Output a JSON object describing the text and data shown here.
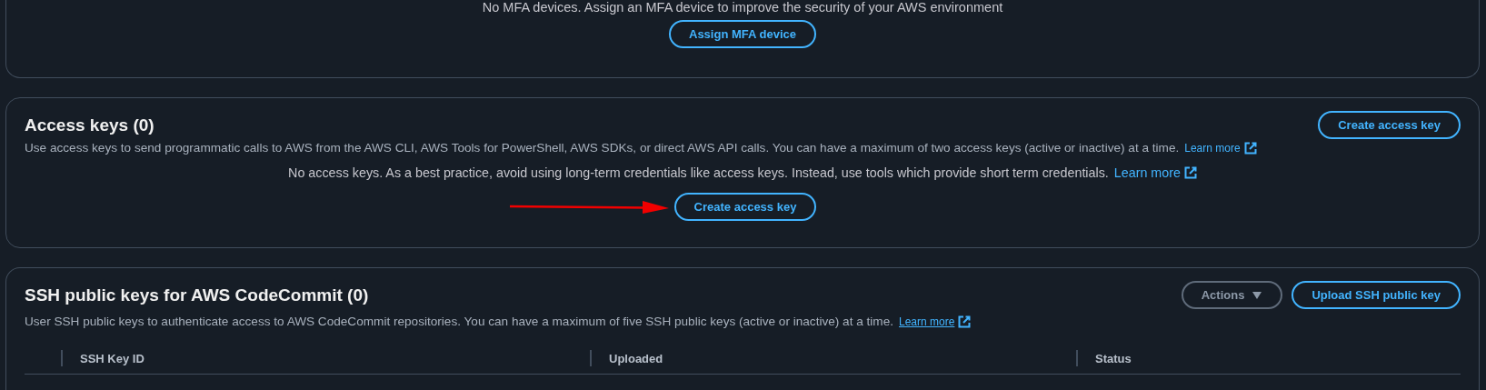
{
  "mfa": {
    "message": "No MFA devices. Assign an MFA device to improve the security of your AWS environment",
    "button": "Assign MFA device"
  },
  "access_keys": {
    "title": "Access keys (0)",
    "description": "Use access keys to send programmatic calls to AWS from the AWS CLI, AWS Tools for PowerShell, AWS SDKs, or direct AWS API calls. You can have a maximum of two access keys (active or inactive) at a time.",
    "learn_more": "Learn more",
    "header_button": "Create access key",
    "empty_message": "No access keys. As a best practice, avoid using long-term credentials like access keys. Instead, use tools which provide short term credentials.",
    "empty_learn_more": "Learn more",
    "empty_button": "Create access key"
  },
  "ssh_keys": {
    "title": "SSH public keys for AWS CodeCommit (0)",
    "description": "User SSH public keys to authenticate access to AWS CodeCommit repositories. You can have a maximum of five SSH public keys (active or inactive) at a time.",
    "learn_more": "Learn more",
    "actions": {
      "label": "Actions",
      "disabled": true
    },
    "upload_button": "Upload SSH public key",
    "columns": [
      "SSH Key ID",
      "Uploaded",
      "Status"
    ]
  }
}
